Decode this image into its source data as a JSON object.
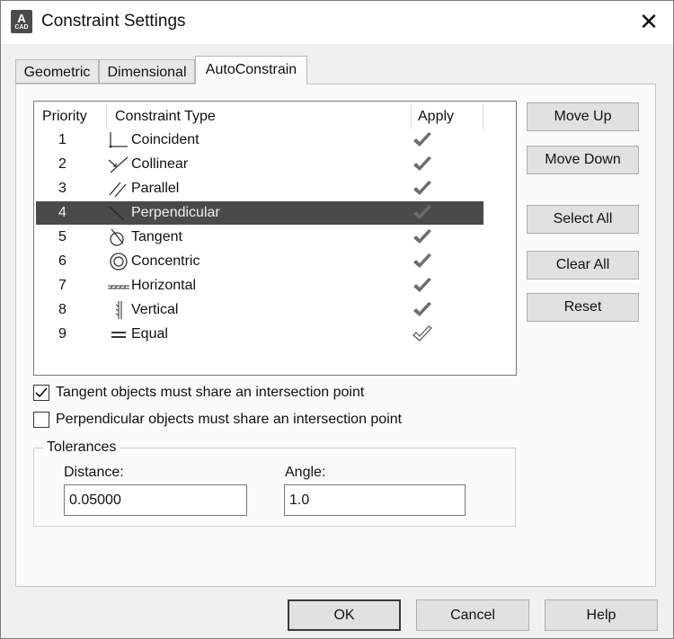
{
  "window": {
    "title": "Constraint Settings",
    "app_icon_letter": "A",
    "app_icon_sub": "CAD",
    "close_glyph": "✕"
  },
  "tabs": [
    {
      "label": "Geometric",
      "active": false
    },
    {
      "label": "Dimensional",
      "active": false
    },
    {
      "label": "AutoConstrain",
      "active": true
    }
  ],
  "table": {
    "headers": {
      "priority": "Priority",
      "type": "Constraint Type",
      "apply": "Apply"
    },
    "rows": [
      {
        "priority": "1",
        "type": "Coincident",
        "icon": "coincident-icon",
        "apply": true
      },
      {
        "priority": "2",
        "type": "Collinear",
        "icon": "collinear-icon",
        "apply": true
      },
      {
        "priority": "3",
        "type": "Parallel",
        "icon": "parallel-icon",
        "apply": true
      },
      {
        "priority": "4",
        "type": "Perpendicular",
        "icon": "perpendicular-icon",
        "apply": true,
        "selected": true
      },
      {
        "priority": "5",
        "type": "Tangent",
        "icon": "tangent-icon",
        "apply": true
      },
      {
        "priority": "6",
        "type": "Concentric",
        "icon": "concentric-icon",
        "apply": true
      },
      {
        "priority": "7",
        "type": "Horizontal",
        "icon": "horizontal-icon",
        "apply": true
      },
      {
        "priority": "8",
        "type": "Vertical",
        "icon": "vertical-icon",
        "apply": true
      },
      {
        "priority": "9",
        "type": "Equal",
        "icon": "equal-icon",
        "apply": false
      }
    ]
  },
  "side_buttons": {
    "move_up": "Move Up",
    "move_down": "Move Down",
    "select_all": "Select All",
    "clear_all": "Clear All",
    "reset": "Reset"
  },
  "options": {
    "tangent": {
      "label": "Tangent objects must share an intersection point",
      "checked": true
    },
    "perpendicular": {
      "label": "Perpendicular objects must share an intersection point",
      "checked": false
    }
  },
  "tolerances": {
    "title": "Tolerances",
    "distance_label": "Distance:",
    "distance_value": "0.05000",
    "angle_label": "Angle:",
    "angle_value": "1.0"
  },
  "footer": {
    "ok": "OK",
    "cancel": "Cancel",
    "help": "Help"
  },
  "colors": {
    "selection": "#4a4a4a",
    "check": "#6e6e6e"
  }
}
